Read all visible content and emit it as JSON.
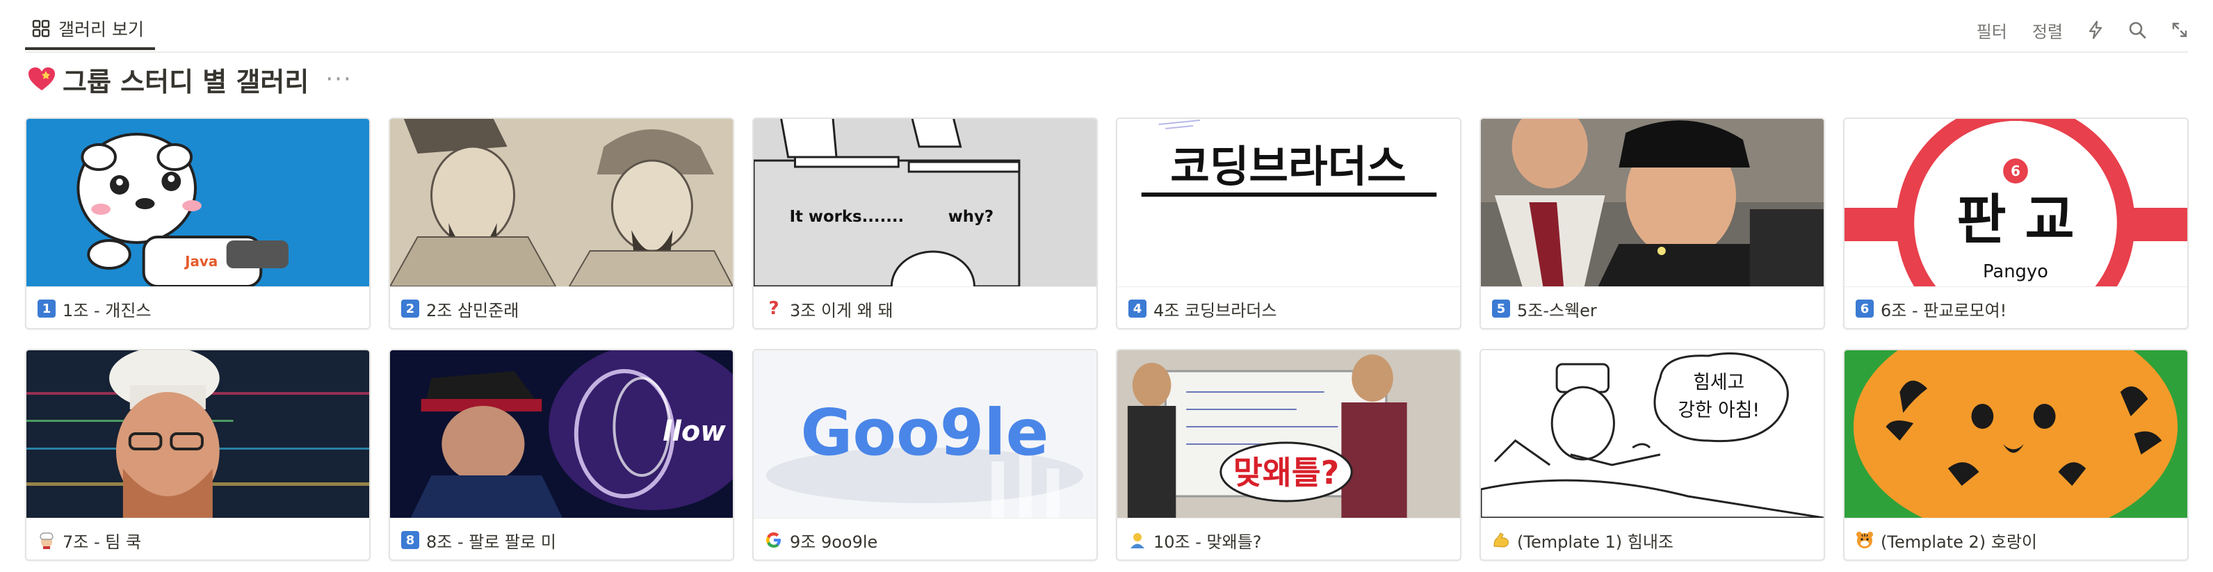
{
  "view_tab": {
    "label": "갤러리 보기",
    "icon": "gallery-grid-icon"
  },
  "toolbar": {
    "filter_label": "필터",
    "sort_label": "정렬",
    "icons": [
      "lightning-icon",
      "search-icon",
      "expand-icon"
    ]
  },
  "database": {
    "title": "그룹 스터디 별 갤러리",
    "title_icon": "heart-icon",
    "more": "···"
  },
  "colors": {
    "keycap_blue": "#3b7bd4",
    "accent_text": "#37352f",
    "muted": "#787774"
  },
  "cards": [
    {
      "badge": "1",
      "icon": "keycap-1-icon",
      "title": "1조 - 개진스",
      "thumb_text": "Java"
    },
    {
      "badge": "2",
      "icon": "keycap-2-icon",
      "title": "2조 삼민준래"
    },
    {
      "badge": "?",
      "icon": "question-mark-icon",
      "title": "3조 이게 왜 돼",
      "thumb_text_1": "It works.......",
      "thumb_text_2": "why?"
    },
    {
      "badge": "4",
      "icon": "keycap-4-icon",
      "title": "4조 코딩브라더스",
      "thumb_text": "코딩브라더스"
    },
    {
      "badge": "5",
      "icon": "keycap-5-icon",
      "title": "5조-스웩er"
    },
    {
      "badge": "6",
      "icon": "keycap-6-icon",
      "title": "6조 - 판교로모여!",
      "thumb_text": "판 교",
      "thumb_sub": "Pangyo",
      "thumb_num": "6"
    },
    {
      "badge": "",
      "icon": "chef-icon",
      "title": "7조 - 팀 쿡"
    },
    {
      "badge": "8",
      "icon": "keycap-8-icon",
      "title": "8조 - 팔로 팔로 미",
      "thumb_text": "llow Me"
    },
    {
      "badge": "",
      "icon": "google-g-icon",
      "title": "9조 9oo9le",
      "thumb_text": "Goo9le"
    },
    {
      "badge": "",
      "icon": "person-icon",
      "title": "10조 - 맞왜틀?",
      "thumb_text": "맞왜틀?"
    },
    {
      "badge": "",
      "icon": "flexed-biceps-icon",
      "title": "(Template 1) 힘내조",
      "thumb_text_1": "힘세고",
      "thumb_text_2": "강한 아침!"
    },
    {
      "badge": "",
      "icon": "tiger-face-icon",
      "title": "(Template 2) 호랑이"
    }
  ]
}
